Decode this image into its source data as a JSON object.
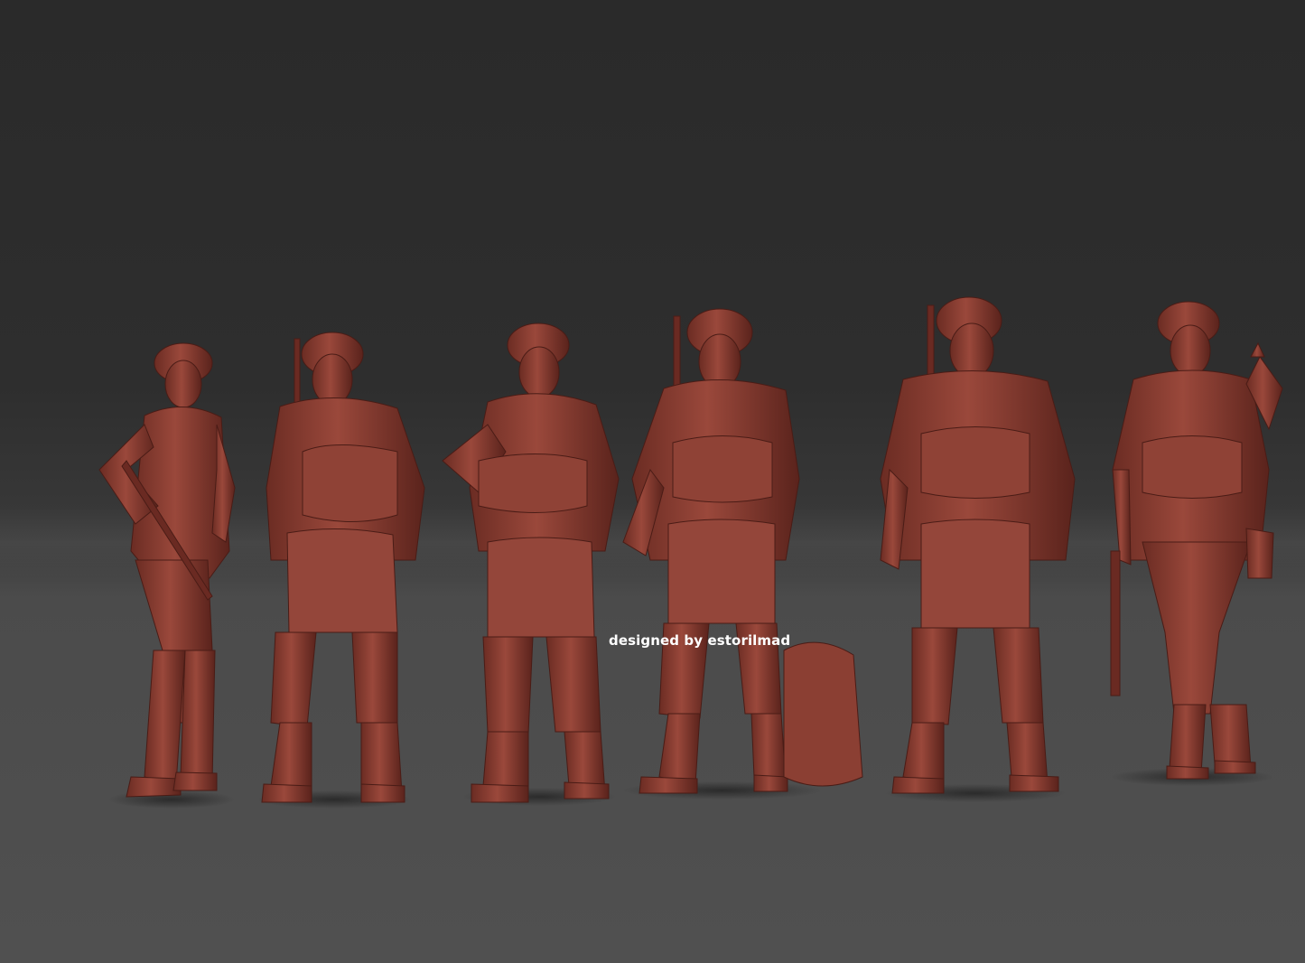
{
  "scene": {
    "watermark": "designed by estorilmad",
    "subject": "six-figure-render",
    "colors": {
      "background_top": "#2a2a2a",
      "floor": "#505050",
      "figure": "#8a3e33",
      "figure_shadow": "#5c241d",
      "figure_highlight": "#a8574a",
      "watermark": "#ffffff"
    }
  }
}
